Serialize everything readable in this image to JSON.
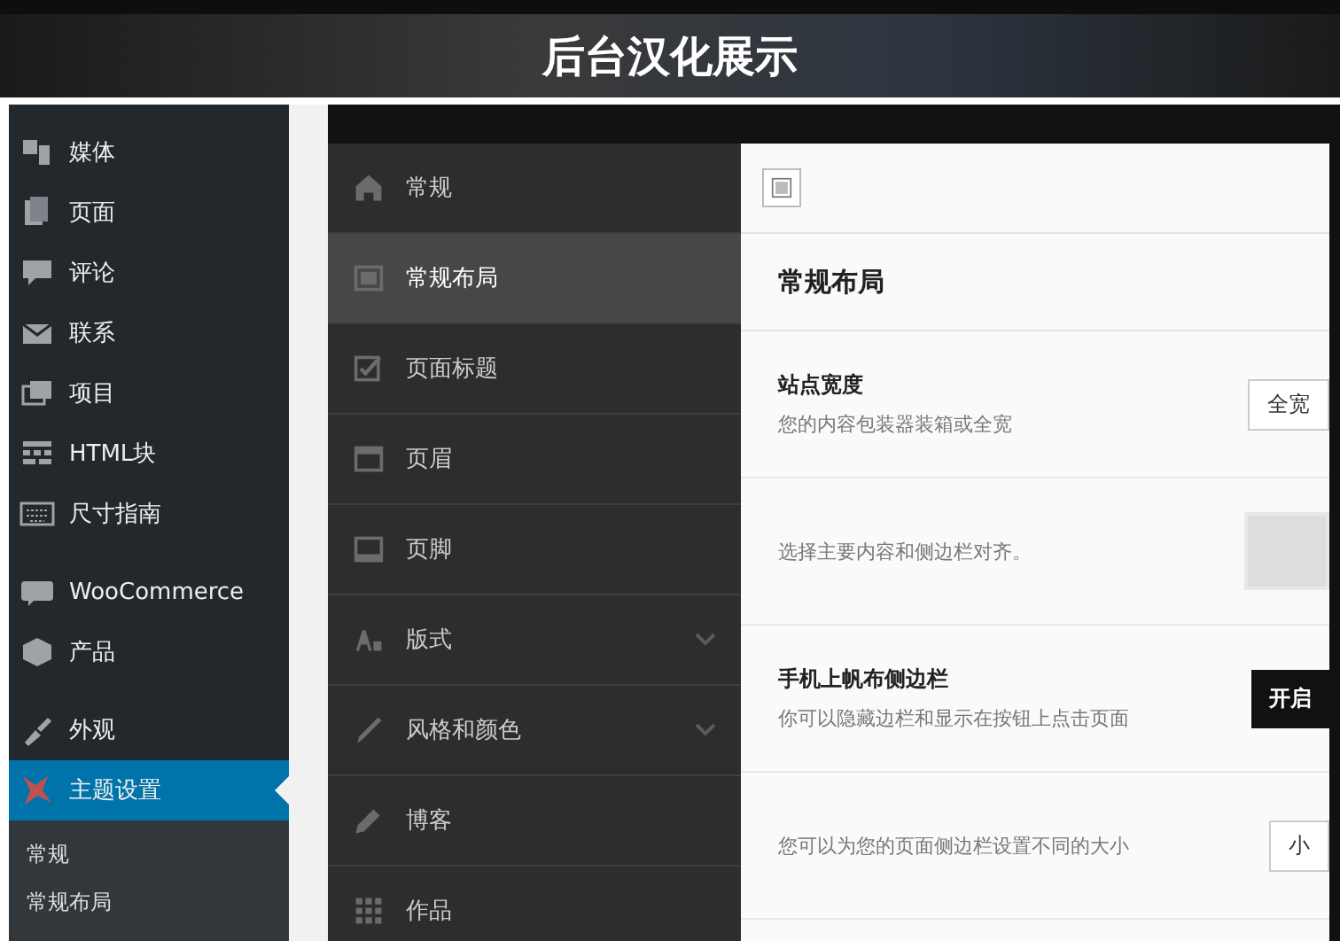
{
  "banner": {
    "title": "后台汉化展示"
  },
  "wp_menu": {
    "groups": [
      [
        {
          "label": "媒体",
          "selected": false
        },
        {
          "label": "页面",
          "selected": false
        },
        {
          "label": "评论",
          "selected": false
        },
        {
          "label": "联系",
          "selected": false
        },
        {
          "label": "项目",
          "selected": false
        },
        {
          "label": "HTML块",
          "selected": false
        },
        {
          "label": "尺寸指南",
          "selected": false
        }
      ],
      [
        {
          "label": "WooCommerce",
          "selected": false
        },
        {
          "label": "产品",
          "selected": false
        }
      ],
      [
        {
          "label": "外观",
          "selected": false
        },
        {
          "label": "主题设置",
          "selected": true
        }
      ]
    ],
    "submenu": [
      "常规",
      "常规布局"
    ]
  },
  "theme_nav": {
    "items": [
      {
        "label": "常规",
        "selected": false,
        "expandable": false
      },
      {
        "label": "常规布局",
        "selected": true,
        "expandable": false
      },
      {
        "label": "页面标题",
        "selected": false,
        "expandable": false
      },
      {
        "label": "页眉",
        "selected": false,
        "expandable": false
      },
      {
        "label": "页脚",
        "selected": false,
        "expandable": false
      },
      {
        "label": "版式",
        "selected": false,
        "expandable": true
      },
      {
        "label": "风格和颜色",
        "selected": false,
        "expandable": true
      },
      {
        "label": "博客",
        "selected": false,
        "expandable": false
      },
      {
        "label": "作品",
        "selected": false,
        "expandable": false
      }
    ]
  },
  "content": {
    "heading": "常规布局",
    "settings": [
      {
        "kind": "select",
        "title": "站点宽度",
        "description": "您的内容包装器装箱或全宽",
        "value": "全宽"
      },
      {
        "kind": "image",
        "description": "选择主要内容和侧边栏对齐。"
      },
      {
        "kind": "toggle",
        "title": "手机上帆布侧边栏",
        "description": "你可以隐藏边栏和显示在按钮上点击页面",
        "value": "开启"
      },
      {
        "kind": "select",
        "description": "您可以为您的页面侧边栏设置不同的大小",
        "value": "小"
      }
    ]
  }
}
